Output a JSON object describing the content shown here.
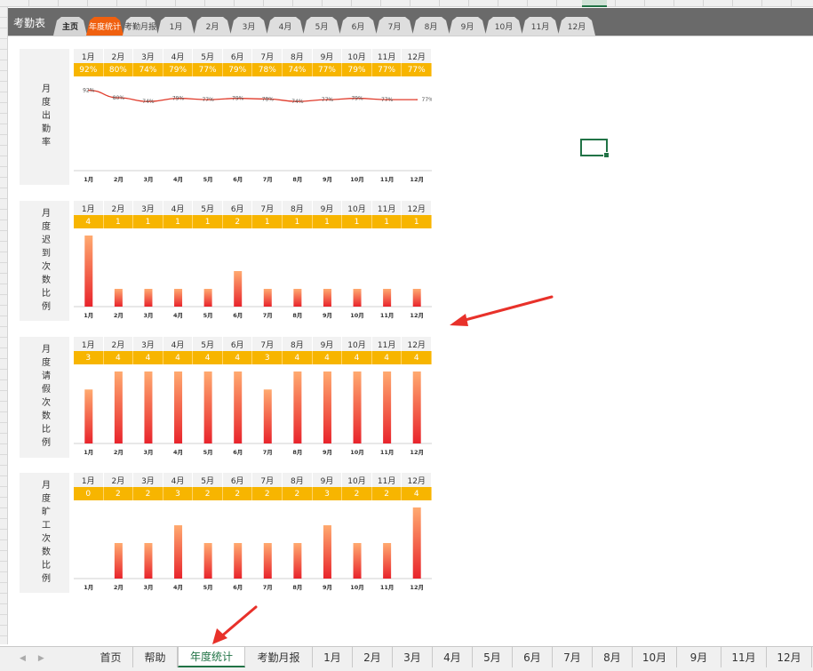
{
  "app": {
    "title": "考勤表"
  },
  "nav_tabs": [
    "主页",
    "年度统计",
    "考勤月报",
    "1月",
    "2月",
    "3月",
    "4月",
    "5月",
    "6月",
    "7月",
    "8月",
    "9月",
    "10月",
    "11月",
    "12月"
  ],
  "nav_active": "年度统计",
  "months": [
    "1月",
    "2月",
    "3月",
    "4月",
    "5月",
    "6月",
    "7月",
    "8月",
    "9月",
    "10月",
    "11月",
    "12月"
  ],
  "blocks": [
    {
      "label": "月度出勤率",
      "type": "line",
      "values": [
        92,
        80,
        74,
        79,
        77,
        79,
        78,
        74,
        77,
        79,
        77,
        77
      ],
      "display": [
        "92%",
        "80%",
        "74%",
        "79%",
        "77%",
        "79%",
        "78%",
        "74%",
        "77%",
        "79%",
        "77%",
        "77%"
      ],
      "ylim": [
        60,
        100
      ],
      "color": "#e03a2a"
    },
    {
      "label": "月度迟到次数比例",
      "type": "bar",
      "values": [
        4,
        1,
        1,
        1,
        1,
        2,
        1,
        1,
        1,
        1,
        1,
        1
      ],
      "display": [
        "4",
        "1",
        "1",
        "1",
        "1",
        "2",
        "1",
        "1",
        "1",
        "1",
        "1",
        "1"
      ],
      "ylim": [
        0,
        4
      ],
      "color": "#f04a25"
    },
    {
      "label": "月度请假次数比例",
      "type": "bar",
      "values": [
        3,
        4,
        4,
        4,
        4,
        4,
        3,
        4,
        4,
        4,
        4,
        4
      ],
      "display": [
        "3",
        "4",
        "4",
        "4",
        "4",
        "4",
        "3",
        "4",
        "4",
        "4",
        "4",
        "4"
      ],
      "ylim": [
        0,
        4
      ],
      "color": "#f04a25"
    },
    {
      "label": "月度旷工次数比例",
      "type": "bar",
      "values": [
        0,
        2,
        2,
        3,
        2,
        2,
        2,
        2,
        3,
        2,
        2,
        4
      ],
      "display": [
        "0",
        "2",
        "2",
        "3",
        "2",
        "2",
        "2",
        "2",
        "3",
        "2",
        "2",
        "4"
      ],
      "ylim": [
        0,
        4
      ],
      "color": "#f04a25"
    }
  ],
  "sheet_tabs": [
    "首页",
    "帮助",
    "年度统计",
    "考勤月报",
    "1月",
    "2月",
    "3月",
    "4月",
    "5月",
    "6月",
    "7月",
    "8月",
    "10月",
    "9月",
    "11月",
    "12月"
  ],
  "sheet_active": "年度统计",
  "colors": {
    "accent": "#f0600f",
    "value_band": "#f7b500",
    "excel_green": "#217346",
    "annotation": "#e8312a"
  }
}
